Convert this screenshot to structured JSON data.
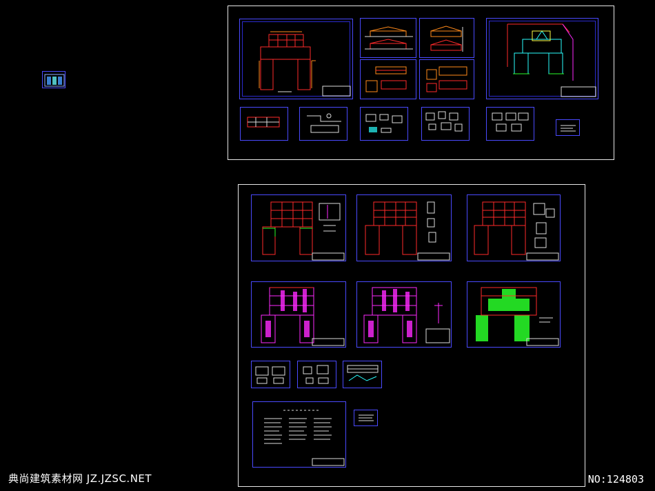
{
  "watermark": {
    "site": "典尚建筑素材网 JZ.JZSC.NET",
    "number": "NO:124803"
  },
  "colors": {
    "background": "#000000",
    "frame": "#e8e8e8",
    "sheet_border": "#4a4aff",
    "red": "#ff2a2a",
    "orange": "#ff8a1a",
    "magenta": "#ff2aff",
    "green": "#2aff2a",
    "cyan": "#2affff",
    "yellow": "#ffff44"
  },
  "icons": [
    "thumbnail-icon"
  ]
}
